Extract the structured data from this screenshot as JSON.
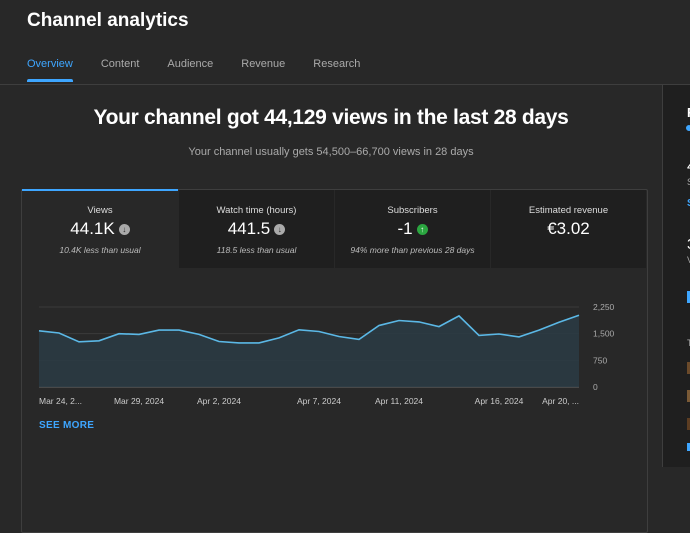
{
  "header": {
    "title": "Channel analytics",
    "tabs": [
      "Overview",
      "Content",
      "Audience",
      "Revenue",
      "Research"
    ],
    "active_tab": "Overview"
  },
  "overview": {
    "headline": "Your channel got 44,129 views in the last 28 days",
    "subline": "Your channel usually gets 54,500–66,700 views in 28 days"
  },
  "metrics": [
    {
      "label": "Views",
      "value": "44.1K",
      "trend": "down",
      "note": "10.4K less than usual",
      "active": true
    },
    {
      "label": "Watch time (hours)",
      "value": "441.5",
      "trend": "down",
      "note": "118.5 less than usual",
      "active": false
    },
    {
      "label": "Subscribers",
      "value": "-1",
      "trend": "up",
      "note": "94% more than previous 28 days",
      "active": false
    },
    {
      "label": "Estimated revenue",
      "value": "€3.02",
      "trend": "",
      "note": "",
      "active": false
    }
  ],
  "chart_data": {
    "type": "area",
    "title": "",
    "xlabel": "",
    "ylabel": "",
    "x_tick_labels": [
      "Mar 24, 2...",
      "Mar 29, 2024",
      "Apr 2, 2024",
      "Apr 7, 2024",
      "Apr 11, 2024",
      "Apr 16, 2024",
      "Apr 20, ..."
    ],
    "y_tick_labels": [
      "2,250",
      "1,500",
      "750",
      "0"
    ],
    "y_ticks": [
      2250,
      1500,
      750,
      0
    ],
    "ylim": [
      0,
      2250
    ],
    "x": [
      "Mar 24",
      "Mar 25",
      "Mar 26",
      "Mar 27",
      "Mar 28",
      "Mar 29",
      "Mar 30",
      "Mar 31",
      "Apr 1",
      "Apr 2",
      "Apr 3",
      "Apr 4",
      "Apr 5",
      "Apr 6",
      "Apr 7",
      "Apr 8",
      "Apr 9",
      "Apr 10",
      "Apr 11",
      "Apr 12",
      "Apr 13",
      "Apr 14",
      "Apr 15",
      "Apr 16",
      "Apr 17",
      "Apr 18",
      "Apr 19",
      "Apr 20"
    ],
    "series": [
      {
        "values": [
          1580,
          1520,
          1270,
          1300,
          1500,
          1480,
          1600,
          1600,
          1480,
          1280,
          1240,
          1240,
          1380,
          1610,
          1560,
          1420,
          1340,
          1730,
          1870,
          1830,
          1700,
          2000,
          1450,
          1490,
          1410,
          1600,
          1820,
          2020
        ]
      }
    ],
    "grid": true,
    "line_color": "#5bb8e6",
    "fill_color": "#2a3b44"
  },
  "see_more": "SEE MORE",
  "right_panel": {
    "fragments": [
      "R",
      "4",
      "S",
      "S",
      "3",
      "V",
      "T"
    ]
  }
}
